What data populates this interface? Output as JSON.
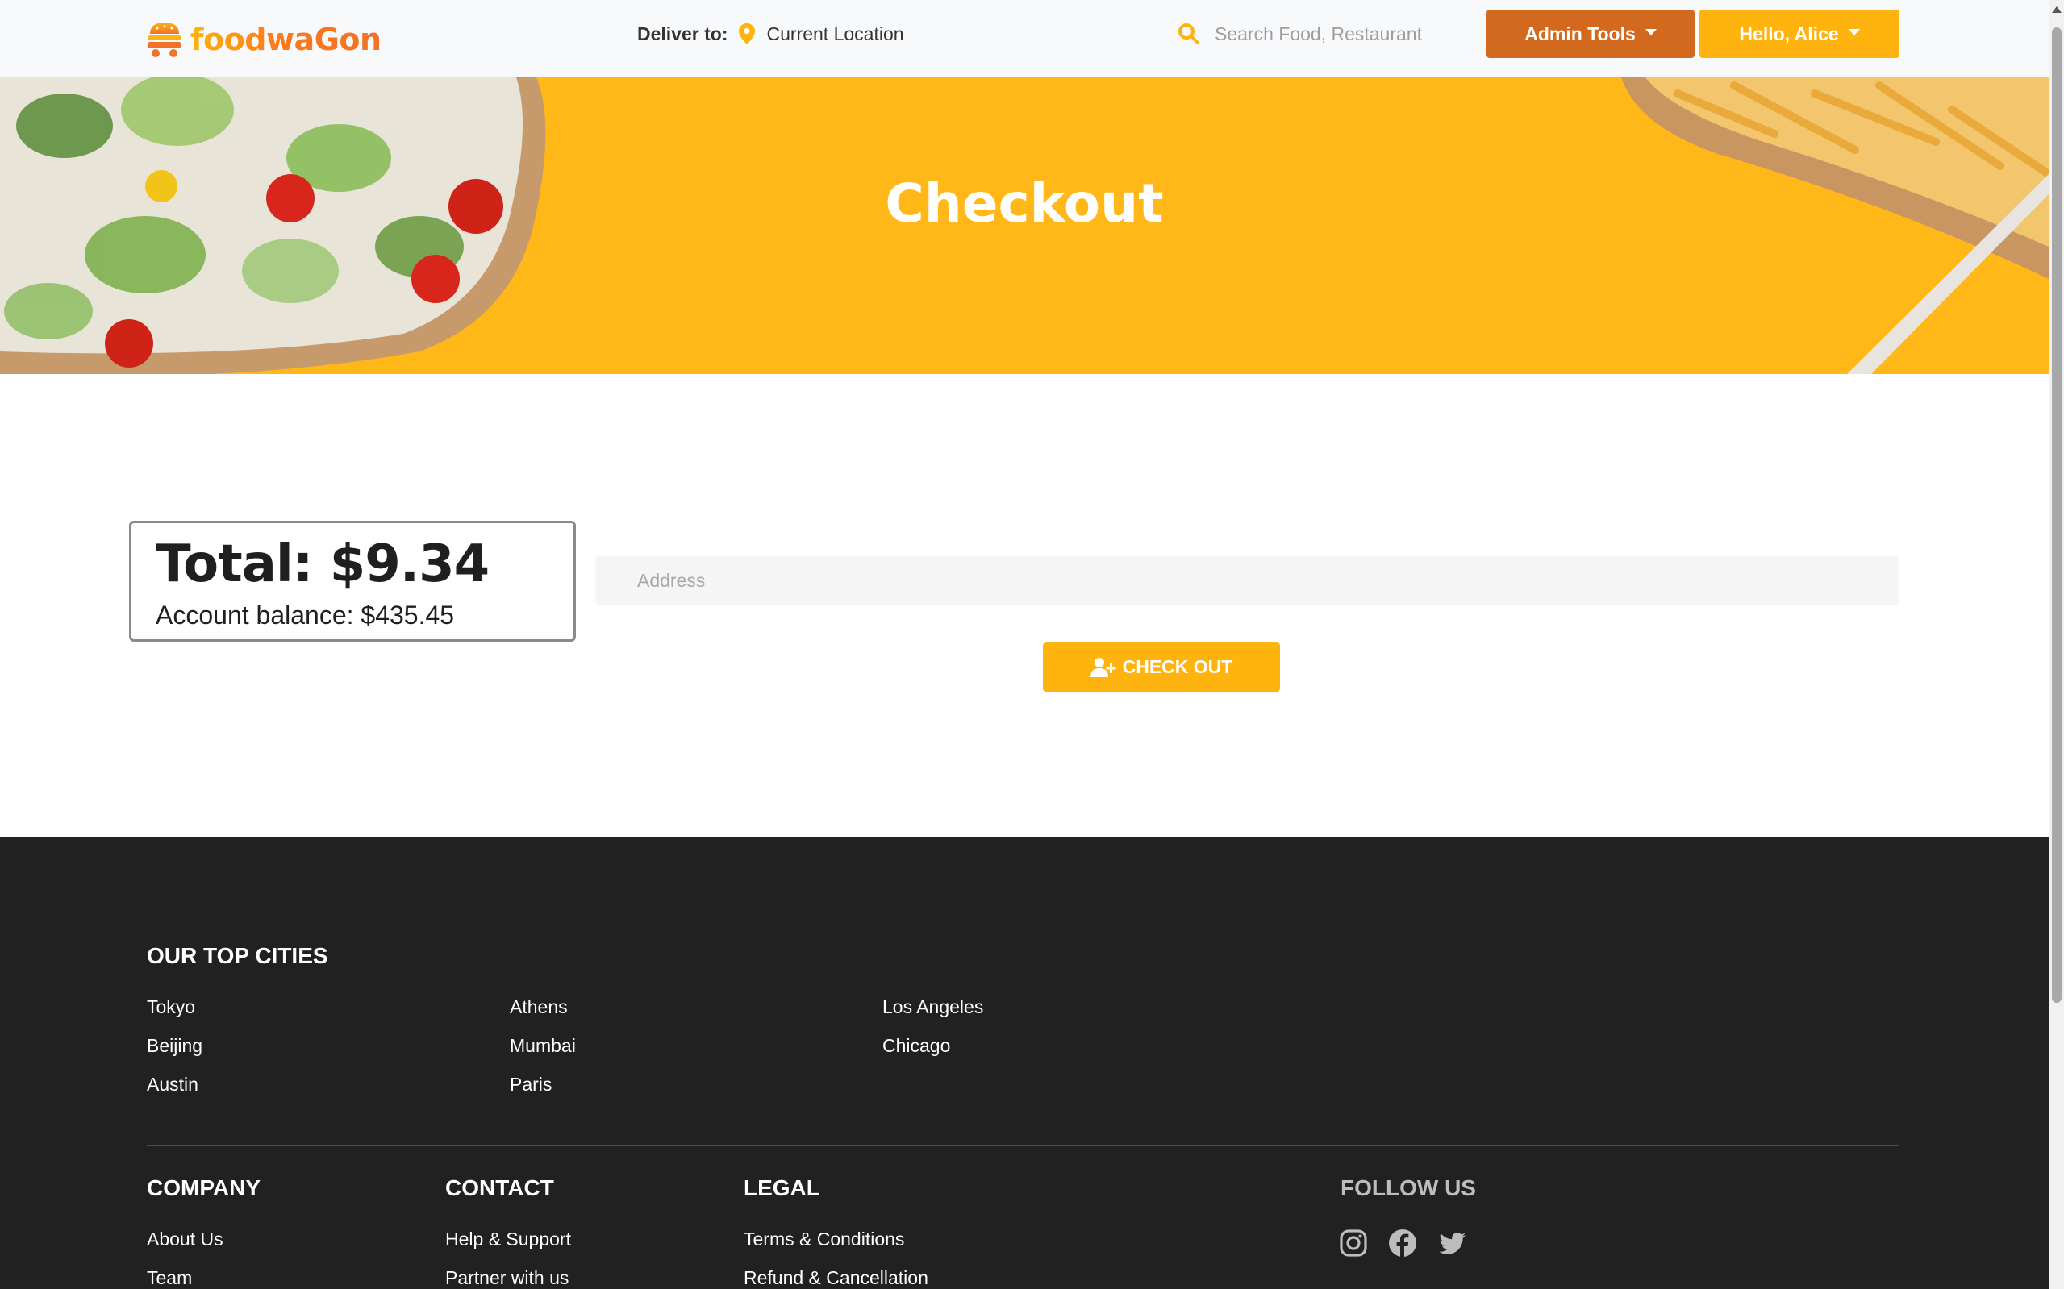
{
  "navbar": {
    "brand": "foodwaGon",
    "deliver_label": "Deliver to:",
    "deliver_value": "Current Location",
    "search_placeholder": "Search Food, Restaurant",
    "admin_label": "Admin Tools",
    "user_label": "Hello, Alice"
  },
  "hero": {
    "title": "Checkout"
  },
  "checkout": {
    "total": "Total: $9.34",
    "balance": "Account balance: $435.45",
    "address_placeholder": "Address",
    "address_value": "",
    "button_label": "CHECK OUT"
  },
  "footer": {
    "cities_heading": "OUR TOP CITIES",
    "cities": [
      "Tokyo",
      "Beijing",
      "Austin",
      "Athens",
      "Mumbai",
      "Paris",
      "Los Angeles",
      "Chicago"
    ],
    "company_heading": "COMPANY",
    "company_links": [
      "About Us",
      "Team"
    ],
    "contact_heading": "CONTACT",
    "contact_links": [
      "Help & Support",
      "Partner with us"
    ],
    "legal_heading": "LEGAL",
    "legal_links": [
      "Terms & Conditions",
      "Refund & Cancellation"
    ],
    "follow_heading": "FOLLOW US",
    "social_icons": [
      "instagram-icon",
      "facebook-icon",
      "twitter-icon"
    ]
  },
  "colors": {
    "brand_yellow": "#ffb30e",
    "admin_orange": "#d2691e",
    "footer_bg": "#212121"
  }
}
